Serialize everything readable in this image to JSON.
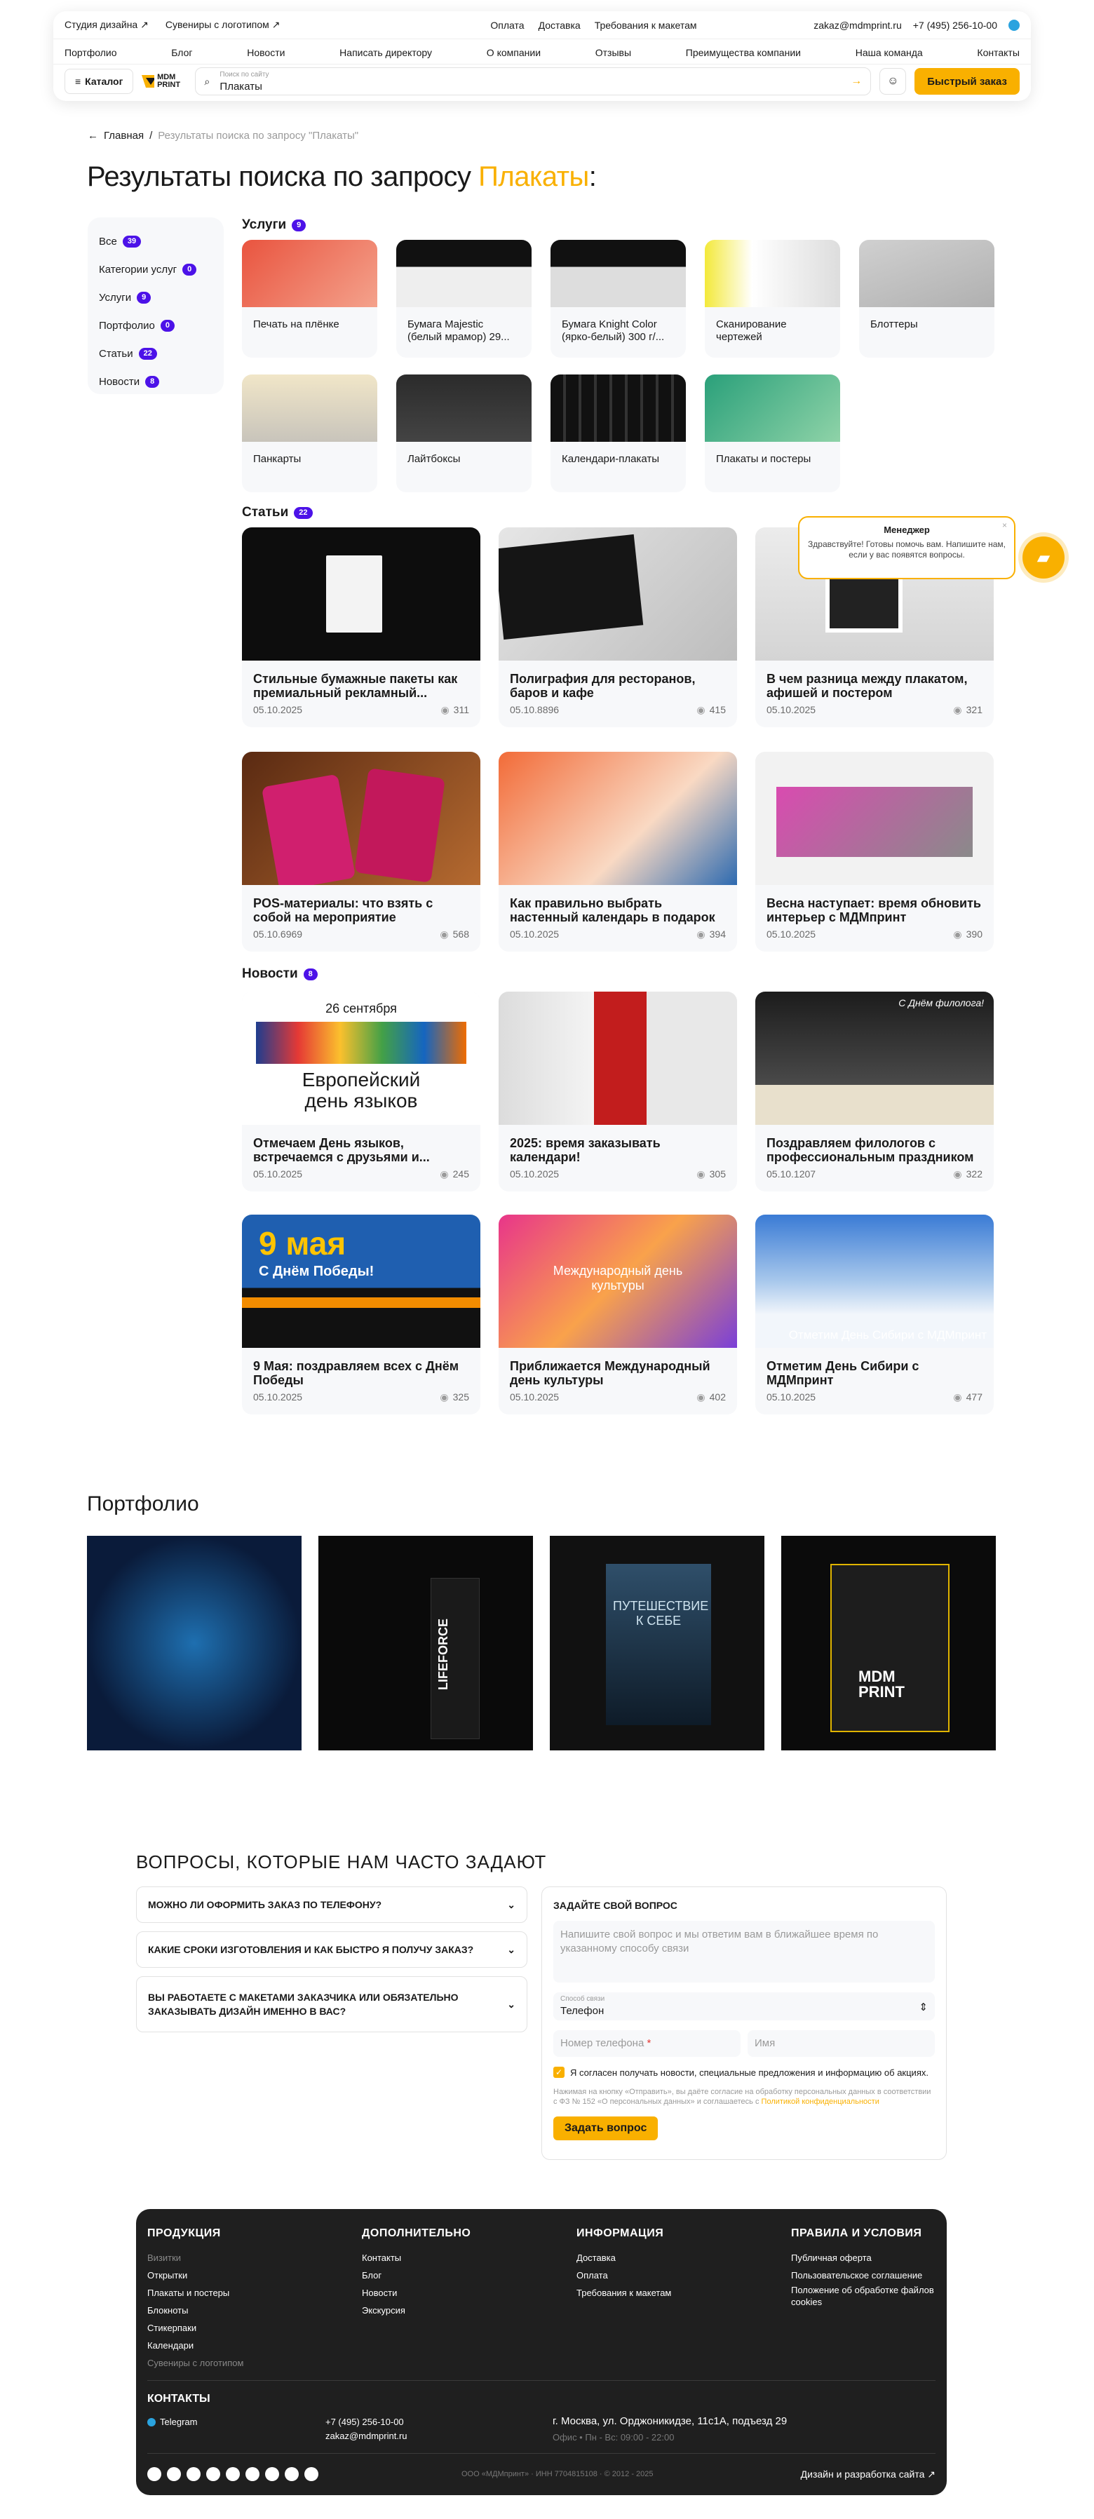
{
  "header": {
    "top_left": [
      "Студия дизайна ↗",
      "Сувениры с логотипом ↗"
    ],
    "top_center": [
      "Оплата",
      "Доставка",
      "Требования к макетам"
    ],
    "email": "zakaz@mdmprint.ru",
    "phone": "+7 (495) 256-10-00",
    "nav": [
      "Портфолио",
      "Блог",
      "Новости",
      "Написать директору",
      "О компании",
      "Отзывы",
      "Преимущества компании",
      "Наша команда",
      "Контакты"
    ],
    "catalog": "Каталог",
    "logo": "MDM PRINT",
    "search_label": "Поиск по сайту",
    "search_value": "Плакаты",
    "quick_order": "Быстрый заказ"
  },
  "breadcrumb": {
    "home": "Главная",
    "sep": "/",
    "current": "Результаты поиска по запросу \"Плакаты\""
  },
  "title": {
    "prefix": "Результаты поиска по запросу ",
    "query": "Плакаты",
    "suffix": ":"
  },
  "sidebar": [
    {
      "label": "Все",
      "count": "39"
    },
    {
      "label": "Категории услуг",
      "count": "0"
    },
    {
      "label": "Услуги",
      "count": "9"
    },
    {
      "label": "Портфолио",
      "count": "0"
    },
    {
      "label": "Статьи",
      "count": "22"
    },
    {
      "label": "Новости",
      "count": "8"
    }
  ],
  "services": {
    "title": "Услуги",
    "count": "9",
    "items": [
      "Печать на плёнке",
      "Бумага Majestic (белый мрамор) 29...",
      "Бумага Knight Color (ярко-белый) 300 г/...",
      "Сканирование чертежей",
      "Блоттеры",
      "Панкарты",
      "Лайтбоксы",
      "Календари-плакаты",
      "Плакаты и постеры"
    ]
  },
  "articles": {
    "title": "Статьи",
    "count": "22",
    "items": [
      {
        "t": "Стильные бумажные пакеты как премиальный рекламный...",
        "d": "05.10.2025",
        "v": "311"
      },
      {
        "t": "Полиграфия для ресторанов, баров и кафе",
        "d": "05.10.8896",
        "v": "415"
      },
      {
        "t": "В чем разница между плакатом, афишей и постером",
        "d": "05.10.2025",
        "v": "321"
      },
      {
        "t": "POS-материалы: что взять с собой на мероприятие",
        "d": "05.10.6969",
        "v": "568"
      },
      {
        "t": "Как правильно выбрать настенный календарь в подарок",
        "d": "05.10.2025",
        "v": "394"
      },
      {
        "t": "Весна наступает: время обновить интерьер с МДМпринт",
        "d": "05.10.2025",
        "v": "390"
      }
    ]
  },
  "news": {
    "title": "Новости",
    "count": "8",
    "items": [
      {
        "t": "Отмечаем День языков, встречаемся с друзьями и...",
        "d": "05.10.2025",
        "v": "245",
        "overlay": "26 сентября|Европейский день языков"
      },
      {
        "t": "2025: время заказывать календари!",
        "d": "05.10.2025",
        "v": "305",
        "overlay": ""
      },
      {
        "t": "Поздравляем филологов с профессиональным праздником",
        "d": "05.10.1207",
        "v": "322",
        "overlay": "С Днём филолога!"
      },
      {
        "t": "9 Мая: поздравляем всех с Днём Победы",
        "d": "05.10.2025",
        "v": "325",
        "overlay": "9 мая|С Днём Победы!"
      },
      {
        "t": "Приближается Международный день культуры",
        "d": "05.10.2025",
        "v": "402",
        "overlay": "Международный день культуры"
      },
      {
        "t": "Отметим День Сибири с МДМпринт",
        "d": "05.10.2025",
        "v": "477",
        "overlay": "Отметим День Сибири с МДМпринт"
      }
    ]
  },
  "chat": {
    "title": "Менеджер",
    "text": "Здравствуйте! Готовы помочь вам. Напишите нам, если у вас появятся вопросы."
  },
  "portfolio": {
    "title": "Портфолио",
    "items": [
      "",
      "LIFEFORCE",
      "ПУТЕШЕСТВИЕ К СЕБЕ",
      "MDM PRINT"
    ]
  },
  "faq": {
    "title": "ВОПРОСЫ, КОТОРЫЕ НАМ ЧАСТО ЗАДАЮТ",
    "items": [
      "МОЖНО ЛИ ОФОРМИТЬ ЗАКАЗ ПО ТЕЛЕФОНУ?",
      "КАКИЕ СРОКИ ИЗГОТОВЛЕНИЯ И КАК БЫСТРО Я ПОЛУЧУ ЗАКАЗ?",
      "ВЫ РАБОТАЕТЕ С МАКЕТАМИ ЗАКАЗЧИКА ИЛИ ОБЯЗАТЕЛЬНО ЗАКАЗЫВАТЬ ДИЗАЙН ИМЕННО В ВАС?"
    ],
    "form_title": "ЗАДАЙТЕ СВОЙ ВОПРОС",
    "question_ph": "Напишите свой вопрос и мы ответим вам в ближайшее время по указанному способу связи",
    "method_label": "Способ связи",
    "method_value": "Телефон",
    "phone_ph": "Номер телефона",
    "name_ph": "Имя",
    "consent": "Я согласен получать новости, специальные предложения и информацию об акциях.",
    "legal": "Нажимая на кнопку «Отправить», вы даёте согласие на обработку персональных данных в соответствии с ФЗ № 152 «О персональных данных» и соглашаетесь с",
    "legal_link": "Политикой конфиденциальности",
    "submit": "Задать вопрос"
  },
  "footer": {
    "cols": [
      {
        "h": "ПРОДУКЦИЯ",
        "items": [
          "Визитки",
          "Открытки",
          "Плакаты и постеры",
          "Блокноты",
          "Стикерпаки",
          "Календари",
          "Сувениры с логотипом"
        ]
      },
      {
        "h": "ДОПОЛНИТЕЛЬНО",
        "items": [
          "Контакты",
          "Блог",
          "Новости",
          "Экскурсия"
        ]
      },
      {
        "h": "ИНФОРМАЦИЯ",
        "items": [
          "Доставка",
          "Оплата",
          "Требования к макетам"
        ]
      },
      {
        "h": "ПРАВИЛА И УСЛОВИЯ",
        "items": [
          "Публичная оферта",
          "Пользовательское соглашение",
          "Положение об обработке файлов cookies"
        ]
      }
    ],
    "contacts_title": "КОНТАКТЫ",
    "telegram": "Telegram",
    "phone": "+7 (495) 256-10-00",
    "email": "zakaz@mdmprint.ru",
    "address": "г. Москва, ул. Орджоникидзе, 11с1А, подъезд 29",
    "hours": "Офис • Пн - Вс: 09:00 - 22:00",
    "legal": "ООО «МДМпринт» · ИНН 7704815108 · © 2012 - 2025",
    "dev": "Дизайн и разработка сайта ↗"
  },
  "colors": {
    "accent": "#f9b000",
    "badge": "#4c12e8",
    "footer_bg": "#1f1f1f"
  }
}
